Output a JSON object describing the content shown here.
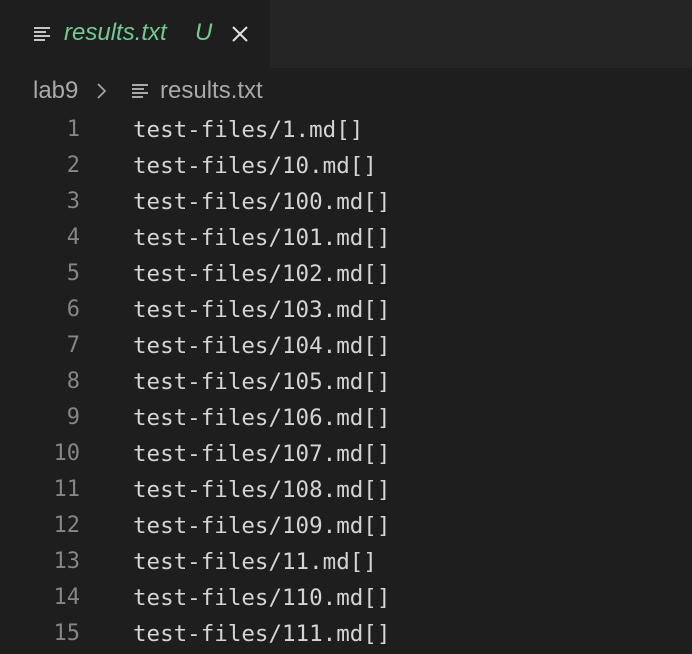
{
  "tab": {
    "filename": "results.txt",
    "status": "U",
    "icon": "lines-file-icon",
    "close_icon": "close-icon"
  },
  "breadcrumb": {
    "folder": "lab9",
    "separator_icon": "chevron-right-icon",
    "file": "results.txt"
  },
  "editor": {
    "lines": [
      {
        "num": "1",
        "text": "test-files/1.md[]"
      },
      {
        "num": "2",
        "text": "test-files/10.md[]"
      },
      {
        "num": "3",
        "text": "test-files/100.md[]"
      },
      {
        "num": "4",
        "text": "test-files/101.md[]"
      },
      {
        "num": "5",
        "text": "test-files/102.md[]"
      },
      {
        "num": "6",
        "text": "test-files/103.md[]"
      },
      {
        "num": "7",
        "text": "test-files/104.md[]"
      },
      {
        "num": "8",
        "text": "test-files/105.md[]"
      },
      {
        "num": "9",
        "text": "test-files/106.md[]"
      },
      {
        "num": "10",
        "text": "test-files/107.md[]"
      },
      {
        "num": "11",
        "text": "test-files/108.md[]"
      },
      {
        "num": "12",
        "text": "test-files/109.md[]"
      },
      {
        "num": "13",
        "text": "test-files/11.md[]"
      },
      {
        "num": "14",
        "text": "test-files/110.md[]"
      },
      {
        "num": "15",
        "text": "test-files/111.md[]"
      }
    ]
  },
  "colors": {
    "background": "#1e1e1e",
    "tabbar": "#252526",
    "untracked": "#73c991",
    "line_number": "#858585",
    "text": "#d4d4d4"
  }
}
